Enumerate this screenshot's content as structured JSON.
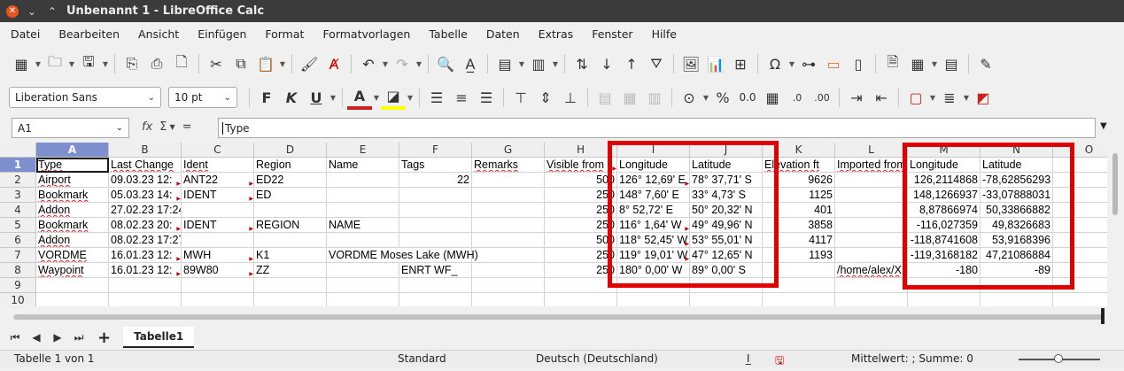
{
  "window": {
    "title": "Unbenannt 1 - LibreOffice Calc"
  },
  "menu": [
    "Datei",
    "Bearbeiten",
    "Ansicht",
    "Einfügen",
    "Format",
    "Formatvorlagen",
    "Tabelle",
    "Daten",
    "Extras",
    "Fenster",
    "Hilfe"
  ],
  "format_bar": {
    "font_name": "Liberation Sans",
    "font_size": "10 pt"
  },
  "formula_bar": {
    "name_box": "A1",
    "content": "Type"
  },
  "columns": [
    "A",
    "B",
    "C",
    "D",
    "E",
    "F",
    "G",
    "H",
    "I",
    "J",
    "K",
    "L",
    "M",
    "N",
    "O"
  ],
  "rows": [
    "1",
    "2",
    "3",
    "4",
    "5",
    "6",
    "7",
    "8",
    "9",
    "10"
  ],
  "cells": [
    [
      "Type",
      "Last Change",
      "Ident",
      "Region",
      "Name",
      "Tags",
      "Remarks",
      "Visible from",
      "Longitude",
      "Latitude",
      "Elevation ft",
      "Imported from",
      "Longitude",
      "Latitude",
      ""
    ],
    [
      "Airport",
      "09.03.23 12:",
      "ANT22",
      "ED22",
      "",
      "22",
      "",
      "500",
      "126° 12,69' E",
      "78° 37,71' S",
      "9626",
      "",
      "126,2114868",
      "-78,62856293",
      ""
    ],
    [
      "Bookmark",
      "05.03.23 14:",
      "IDENT",
      "ED",
      "",
      "",
      "",
      "250",
      "148° 7,60' E",
      "33° 4,73' S",
      "1125",
      "",
      "148,1266937",
      "-33,07888031",
      ""
    ],
    [
      "Addon",
      "27.02.23 17:24",
      "",
      "",
      "",
      "",
      "",
      "250",
      "8° 52,72' E",
      "50° 20,32' N",
      "401",
      "",
      "8,87866974",
      "50,33866882",
      ""
    ],
    [
      "Bookmark",
      "08.02.23 20:",
      "IDENT",
      "REGION",
      "NAME",
      "",
      "",
      "250",
      "116° 1,64' W",
      "49° 49,96' N",
      "3858",
      "",
      "-116,027359",
      "49,8326683",
      ""
    ],
    [
      "Addon",
      "08.02.23 17:27",
      "",
      "",
      "",
      "",
      "",
      "500",
      "118° 52,45' W",
      "53° 55,01' N",
      "4117",
      "",
      "-118,8741608",
      "53,9168396",
      ""
    ],
    [
      "VORDME",
      "16.01.23 12:",
      "MWH",
      "K1",
      "VORDME Moses Lake (MWH)",
      "",
      "",
      "250",
      "119° 19,01' W",
      "47° 12,65' N",
      "1193",
      "",
      "-119,3168182",
      "47,21086884",
      ""
    ],
    [
      "Waypoint",
      "16.01.23 12:",
      "89W80",
      "ZZ",
      "",
      "ENRT WF_",
      "",
      "250",
      "180° 0,00' W",
      "89° 0,00' S",
      "",
      "/home/alex/X",
      "-180",
      "-89",
      ""
    ],
    [
      "",
      "",
      "",
      "",
      "",
      "",
      "",
      "",
      "",
      "",
      "",
      "",
      "",
      "",
      ""
    ],
    [
      "",
      "",
      "",
      "",
      "",
      "",
      "",
      "",
      "",
      "",
      "",
      "",
      "",
      "",
      ""
    ]
  ],
  "sheet_tabs": [
    "Tabelle1"
  ],
  "status": {
    "sheet_info": "Tabelle 1 von 1",
    "style": "Standard",
    "language": "Deutsch (Deutschland)",
    "summary": "Mittelwert: ; Summe: 0"
  }
}
